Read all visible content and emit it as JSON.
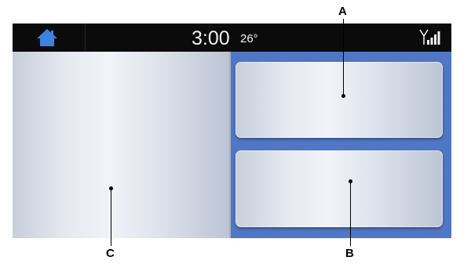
{
  "status_bar": {
    "home_icon": "home-icon",
    "clock": "3:00",
    "temperature": "26°",
    "signal_icon": "signal-strength-icon",
    "colors": {
      "background": "#0b0b0b",
      "home": "#3b82e0",
      "text": "#f2f2f2"
    }
  },
  "screen": {
    "background": "#4f77c5"
  },
  "callouts": {
    "a": "A",
    "b": "B",
    "c": "C"
  }
}
